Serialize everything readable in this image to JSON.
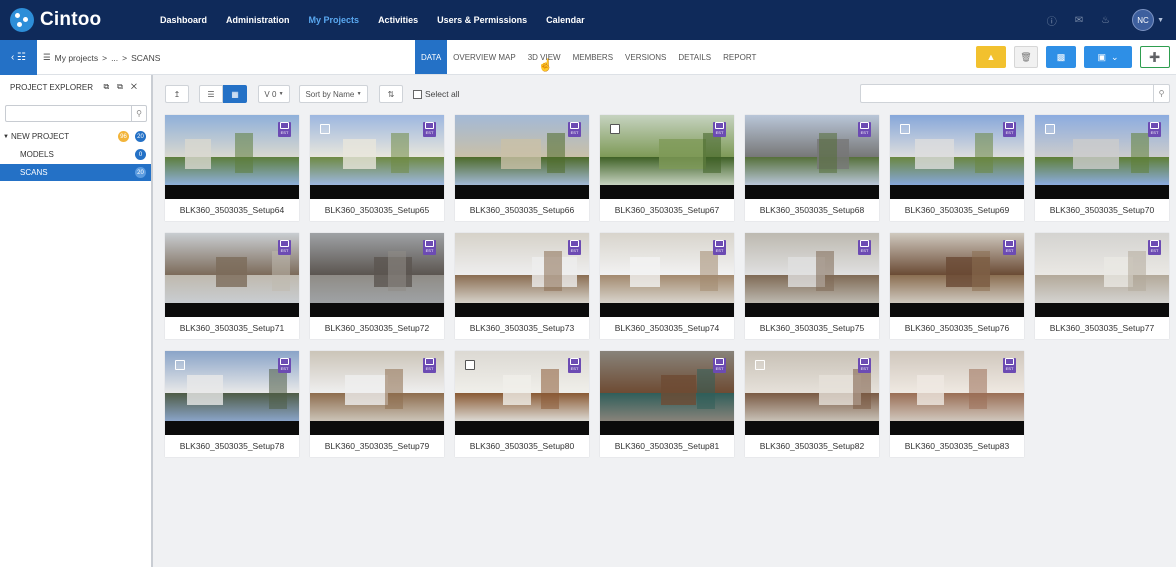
{
  "app": {
    "name": "Cintoo"
  },
  "nav": [
    "Dashboard",
    "Administration",
    "My Projects",
    "Activities",
    "Users & Permissions",
    "Calendar"
  ],
  "nav_active": "My Projects",
  "user": {
    "initials": "NC"
  },
  "breadcrumb": {
    "root": "My projects",
    "sep": ">",
    "ellipsis": "...",
    "current": "SCANS"
  },
  "tabs": [
    "DATA",
    "OVERVIEW MAP",
    "3D VIEW",
    "MEMBERS",
    "VERSIONS",
    "DETAILS",
    "REPORT"
  ],
  "active_tab": "DATA",
  "sidebar": {
    "title": "PROJECT EXPLORER",
    "tree": [
      {
        "label": "NEW PROJECT",
        "badge_orange": "96",
        "badge_blue": "20"
      },
      {
        "label": "MODELS",
        "badge_blue": "0"
      },
      {
        "label": "SCANS",
        "badge_blue": "20"
      }
    ]
  },
  "toolbar": {
    "version": "V 0",
    "sort": "Sort by Name",
    "select_all": "Select all"
  },
  "scans": [
    "BLK360_3503035_Setup64",
    "BLK360_3503035_Setup65",
    "BLK360_3503035_Setup66",
    "BLK360_3503035_Setup67",
    "BLK360_3503035_Setup68",
    "BLK360_3503035_Setup69",
    "BLK360_3503035_Setup70",
    "BLK360_3503035_Setup71",
    "BLK360_3503035_Setup72",
    "BLK360_3503035_Setup73",
    "BLK360_3503035_Setup74",
    "BLK360_3503035_Setup75",
    "BLK360_3503035_Setup76",
    "BLK360_3503035_Setup77",
    "BLK360_3503035_Setup78",
    "BLK360_3503035_Setup79",
    "BLK360_3503035_Setup80",
    "BLK360_3503035_Setup81",
    "BLK360_3503035_Setup82",
    "BLK360_3503035_Setup83"
  ],
  "scan_tag": "EST",
  "colors": {
    "nav_bg": "#0f2a5a",
    "accent": "#2471c6",
    "yellow": "#f2c12e",
    "purple_tag": "#6c4bb3",
    "green": "#2e9e4f"
  }
}
